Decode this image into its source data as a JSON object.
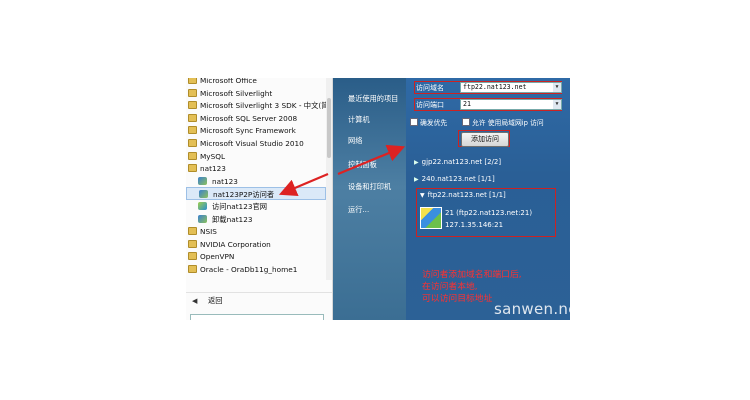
{
  "programs": [
    {
      "label": "Microsoft Office",
      "kind": "folder"
    },
    {
      "label": "Microsoft Silverlight",
      "kind": "folder"
    },
    {
      "label": "Microsoft Silverlight 3 SDK - 中文(简",
      "kind": "folder"
    },
    {
      "label": "Microsoft SQL Server 2008",
      "kind": "folder"
    },
    {
      "label": "Microsoft Sync Framework",
      "kind": "folder"
    },
    {
      "label": "Microsoft Visual Studio 2010",
      "kind": "folder"
    },
    {
      "label": "MySQL",
      "kind": "folder"
    },
    {
      "label": "nat123",
      "kind": "folder"
    },
    {
      "label": "nat123",
      "kind": "app",
      "sub": true
    },
    {
      "label": "nat123P2P访问者",
      "kind": "app",
      "sub": true,
      "selected": true
    },
    {
      "label": "访问nat123官网",
      "kind": "app2",
      "sub": true
    },
    {
      "label": "卸载nat123",
      "kind": "app",
      "sub": true
    },
    {
      "label": "NSIS",
      "kind": "folder"
    },
    {
      "label": "NVIDIA Corporation",
      "kind": "folder"
    },
    {
      "label": "OpenVPN",
      "kind": "folder"
    },
    {
      "label": "Oracle - OraDb11g_home1",
      "kind": "folder"
    }
  ],
  "back_label": "返回",
  "right_column": [
    "最近使用的项目",
    "计算机",
    "网络",
    "控制面板",
    "设备和打印机",
    "运行..."
  ],
  "panel": {
    "domain_label": "访问域名",
    "domain_value": "ftp22.nat123.net",
    "port_label": "访问端口",
    "port_value": "21",
    "check1": "确发优先",
    "check2": "允许 使用局域网ip 访问",
    "add_button": "添加访问",
    "domains": [
      "gjp22.nat123.net  [2/2]",
      "240.nat123.net  [1/1]",
      "ftp22.nat123.net  [1/1]"
    ],
    "entry_line1": "21  (ftp22.nat123.net:21)",
    "entry_line2": "127.1.35.146:21"
  },
  "note_lines": [
    "访问者添加域名和端口后,",
    "在访问者本地,",
    "可以访问目标地址"
  ],
  "watermark": "sanwen.net",
  "colors": {
    "annotation_red": "#cc2222",
    "panel_blue": "#2c6196"
  }
}
